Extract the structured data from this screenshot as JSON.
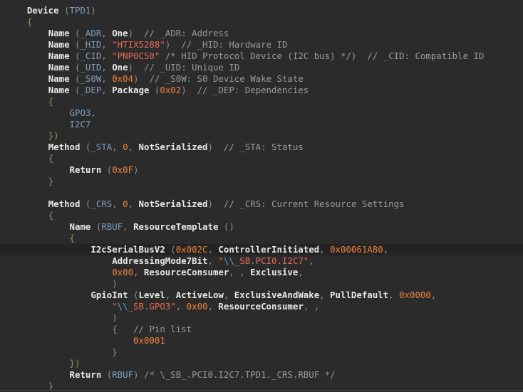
{
  "editor": {
    "lines": [
      {
        "indent": 4,
        "tokens": [
          [
            "kw",
            "Device"
          ],
          [
            "pn",
            " ("
          ],
          [
            "id",
            "TPD1"
          ],
          [
            "pn",
            ")"
          ]
        ]
      },
      {
        "indent": 4,
        "tokens": [
          [
            "br",
            "{"
          ]
        ]
      },
      {
        "indent": 8,
        "tokens": [
          [
            "kw",
            "Name"
          ],
          [
            "pn",
            " ("
          ],
          [
            "id",
            "_ADR"
          ],
          [
            "pn",
            ", "
          ],
          [
            "kw",
            "One"
          ],
          [
            "pn",
            ")  "
          ],
          [
            "cm",
            "// _ADR: Address"
          ]
        ]
      },
      {
        "indent": 8,
        "tokens": [
          [
            "kw",
            "Name"
          ],
          [
            "pn",
            " ("
          ],
          [
            "id",
            "_HID"
          ],
          [
            "pn",
            ", "
          ],
          [
            "st",
            "\"HTIX5288\""
          ],
          [
            "pn",
            ")  "
          ],
          [
            "cm",
            "// _HID: Hardware ID"
          ]
        ]
      },
      {
        "indent": 8,
        "tokens": [
          [
            "kw",
            "Name"
          ],
          [
            "pn",
            " ("
          ],
          [
            "id",
            "_CID"
          ],
          [
            "pn",
            ", "
          ],
          [
            "st",
            "\"PNP0C50\""
          ],
          [
            "pn",
            " "
          ],
          [
            "cm",
            "/* HID Protocol Device (I2C bus) */)  // _CID: Compatible ID"
          ]
        ]
      },
      {
        "indent": 8,
        "tokens": [
          [
            "kw",
            "Name"
          ],
          [
            "pn",
            " ("
          ],
          [
            "id",
            "_UID"
          ],
          [
            "pn",
            ", "
          ],
          [
            "kw",
            "One"
          ],
          [
            "pn",
            ")  "
          ],
          [
            "cm",
            "// _UID: Unique ID"
          ]
        ]
      },
      {
        "indent": 8,
        "tokens": [
          [
            "kw",
            "Name"
          ],
          [
            "pn",
            " ("
          ],
          [
            "id",
            "_S0W"
          ],
          [
            "pn",
            ", "
          ],
          [
            "nm",
            "0x04"
          ],
          [
            "pn",
            ")  "
          ],
          [
            "cm",
            "// _S0W: S0 Device Wake State"
          ]
        ]
      },
      {
        "indent": 8,
        "tokens": [
          [
            "kw",
            "Name"
          ],
          [
            "pn",
            " ("
          ],
          [
            "id",
            "_DEP"
          ],
          [
            "pn",
            ", "
          ],
          [
            "kw",
            "Package"
          ],
          [
            "pn",
            " ("
          ],
          [
            "nm",
            "0x02"
          ],
          [
            "pn",
            ")  "
          ],
          [
            "cm",
            "// _DEP: Dependencies"
          ]
        ]
      },
      {
        "indent": 8,
        "tokens": [
          [
            "br",
            "{"
          ]
        ]
      },
      {
        "indent": 12,
        "tokens": [
          [
            "id",
            "GPO3"
          ],
          [
            "pn",
            ","
          ]
        ]
      },
      {
        "indent": 12,
        "tokens": [
          [
            "id",
            "I2C7"
          ]
        ]
      },
      {
        "indent": 8,
        "tokens": [
          [
            "br",
            "})"
          ]
        ]
      },
      {
        "indent": 8,
        "tokens": [
          [
            "kw",
            "Method"
          ],
          [
            "pn",
            " ("
          ],
          [
            "id",
            "_STA"
          ],
          [
            "pn",
            ", "
          ],
          [
            "nm",
            "0"
          ],
          [
            "pn",
            ", "
          ],
          [
            "kw",
            "NotSerialized"
          ],
          [
            "pn",
            ")  "
          ],
          [
            "cm",
            "// _STA: Status"
          ]
        ]
      },
      {
        "indent": 8,
        "tokens": [
          [
            "br",
            "{"
          ]
        ]
      },
      {
        "indent": 12,
        "tokens": [
          [
            "kw",
            "Return"
          ],
          [
            "pn",
            " ("
          ],
          [
            "nm",
            "0x0F"
          ],
          [
            "pn",
            ")"
          ]
        ]
      },
      {
        "indent": 8,
        "tokens": [
          [
            "br",
            "}"
          ]
        ]
      },
      {
        "indent": 0,
        "tokens": []
      },
      {
        "indent": 8,
        "tokens": [
          [
            "kw",
            "Method"
          ],
          [
            "pn",
            " ("
          ],
          [
            "id",
            "_CRS"
          ],
          [
            "pn",
            ", "
          ],
          [
            "nm",
            "0"
          ],
          [
            "pn",
            ", "
          ],
          [
            "kw",
            "NotSerialized"
          ],
          [
            "pn",
            ")  "
          ],
          [
            "cm",
            "// _CRS: Current Resource Settings"
          ]
        ]
      },
      {
        "indent": 8,
        "tokens": [
          [
            "br",
            "{"
          ]
        ]
      },
      {
        "indent": 12,
        "tokens": [
          [
            "kw",
            "Name"
          ],
          [
            "pn",
            " ("
          ],
          [
            "id",
            "RBUF"
          ],
          [
            "pn",
            ", "
          ],
          [
            "kw",
            "ResourceTemplate"
          ],
          [
            "pn",
            " ()"
          ]
        ]
      },
      {
        "indent": 12,
        "tokens": [
          [
            "br",
            "{"
          ]
        ]
      },
      {
        "indent": 16,
        "current": true,
        "tokens": [
          [
            "kw",
            "I2cSerialBusV2"
          ],
          [
            "pn",
            " ("
          ],
          [
            "nm",
            "0x002C"
          ],
          [
            "pn",
            ", "
          ],
          [
            "kw",
            "ControllerInitiated"
          ],
          [
            "pn",
            ", "
          ],
          [
            "nm",
            "0x00061A80"
          ],
          [
            "pn",
            ","
          ]
        ]
      },
      {
        "indent": 20,
        "tokens": [
          [
            "kw",
            "AddressingMode7Bit"
          ],
          [
            "pn",
            ", "
          ],
          [
            "st",
            "\""
          ],
          [
            "esc",
            "\\\\"
          ],
          [
            "st",
            "_SB.PCI0.I2C7\""
          ],
          [
            "pn",
            ","
          ]
        ]
      },
      {
        "indent": 20,
        "tokens": [
          [
            "nm",
            "0x00"
          ],
          [
            "pn",
            ", "
          ],
          [
            "kw",
            "ResourceConsumer"
          ],
          [
            "pn",
            ", , "
          ],
          [
            "kw",
            "Exclusive"
          ],
          [
            "pn",
            ","
          ]
        ]
      },
      {
        "indent": 20,
        "tokens": [
          [
            "pn",
            ")"
          ]
        ]
      },
      {
        "indent": 16,
        "tokens": [
          [
            "kw",
            "GpioInt"
          ],
          [
            "pn",
            " ("
          ],
          [
            "kw",
            "Level"
          ],
          [
            "pn",
            ", "
          ],
          [
            "kw",
            "ActiveLow"
          ],
          [
            "pn",
            ", "
          ],
          [
            "kw",
            "ExclusiveAndWake"
          ],
          [
            "pn",
            ", "
          ],
          [
            "kw",
            "PullDefault"
          ],
          [
            "pn",
            ", "
          ],
          [
            "nm",
            "0x0000"
          ],
          [
            "pn",
            ","
          ]
        ]
      },
      {
        "indent": 20,
        "tokens": [
          [
            "st",
            "\""
          ],
          [
            "esc",
            "\\\\"
          ],
          [
            "st",
            "_SB.GPO3\""
          ],
          [
            "pn",
            ", "
          ],
          [
            "nm",
            "0x00"
          ],
          [
            "pn",
            ", "
          ],
          [
            "kw",
            "ResourceConsumer"
          ],
          [
            "pn",
            ", ,"
          ]
        ]
      },
      {
        "indent": 20,
        "tokens": [
          [
            "pn",
            ")"
          ]
        ]
      },
      {
        "indent": 20,
        "tokens": [
          [
            "br",
            "{"
          ],
          [
            "pn",
            "   "
          ],
          [
            "cm",
            "// Pin list"
          ]
        ]
      },
      {
        "indent": 24,
        "tokens": [
          [
            "nm",
            "0x0001"
          ]
        ]
      },
      {
        "indent": 20,
        "tokens": [
          [
            "br",
            "}"
          ]
        ]
      },
      {
        "indent": 12,
        "tokens": [
          [
            "br",
            "})"
          ]
        ]
      },
      {
        "indent": 12,
        "tokens": [
          [
            "kw",
            "Return"
          ],
          [
            "pn",
            " ("
          ],
          [
            "id",
            "RBUF"
          ],
          [
            "pn",
            ") "
          ],
          [
            "cm",
            "/* \\_SB_.PCI0.I2C7.TPD1._CRS.RBUF */"
          ]
        ]
      },
      {
        "indent": 8,
        "tokens": [
          [
            "br",
            "}"
          ]
        ]
      }
    ]
  }
}
